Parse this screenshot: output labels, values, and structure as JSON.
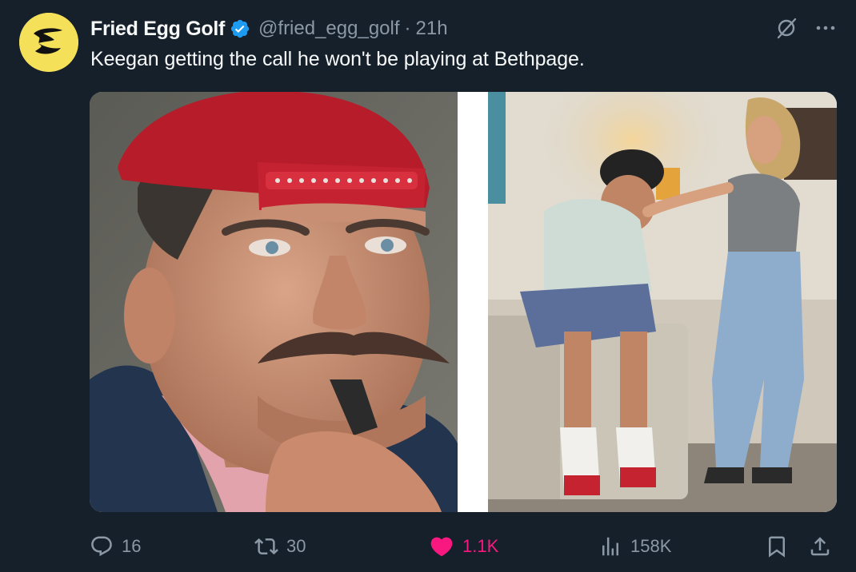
{
  "tweet": {
    "display_name": "Fried Egg Golf",
    "handle": "@fried_egg_golf",
    "separator": "·",
    "time": "21h",
    "text": "Keegan getting the call he won't be playing at Bethpage."
  },
  "avatar": {
    "icon": "fried-egg-logo",
    "bg_color": "#f5e05a"
  },
  "media": {
    "images": [
      {
        "icon": "photo-man-red-cap"
      },
      {
        "icon": "photo-couple-living-room"
      }
    ]
  },
  "actions": {
    "replies": "16",
    "reposts": "30",
    "likes": "1.1K",
    "views": "158K"
  },
  "colors": {
    "background": "#15202b",
    "secondary_text": "#8b98a5",
    "like": "#f91880",
    "verified": "#1d9bf0"
  }
}
